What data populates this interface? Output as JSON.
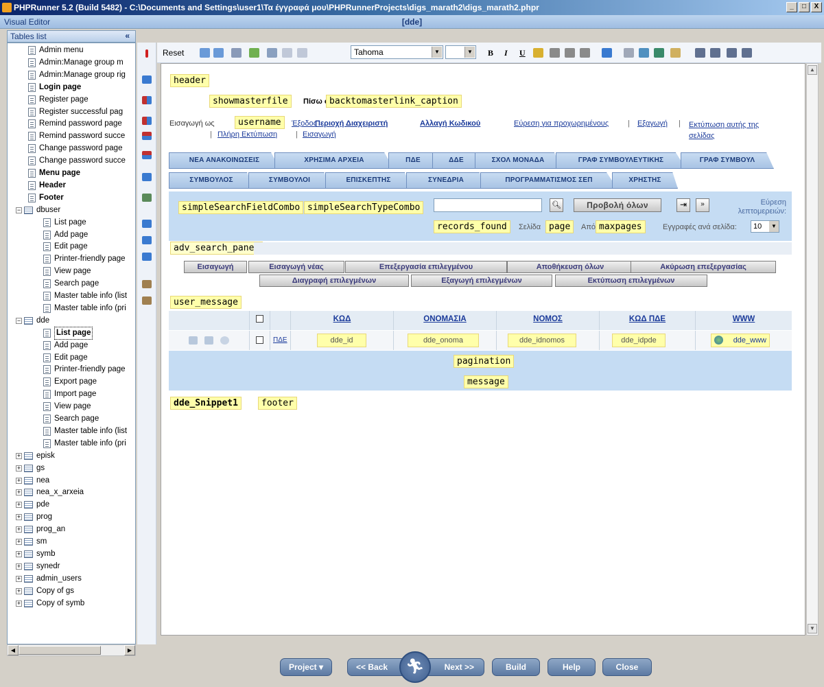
{
  "window": {
    "title": "PHPRunner 5.2 (Build 5482) - C:\\Documents and Settings\\user1\\Τα έγγραφά μου\\PHPRunnerProjects\\digs_marath2\\digs_marath2.phpr",
    "controls": [
      "_",
      "□",
      "X"
    ]
  },
  "editor_bar": {
    "label": "Visual Editor",
    "title": "[dde]"
  },
  "tables_panel": {
    "title": "Tables list",
    "collapse": "«",
    "items": [
      {
        "label": "Admin menu",
        "icon": "page-icon",
        "bold": false
      },
      {
        "label": "Admin:Manage group m",
        "icon": "page-icon",
        "bold": false
      },
      {
        "label": "Admin:Manage group rig",
        "icon": "page-icon",
        "bold": false
      },
      {
        "label": "Login page",
        "icon": "page-icon",
        "bold": true
      },
      {
        "label": "Register page",
        "icon": "page-icon",
        "bold": false
      },
      {
        "label": "Register successful pag",
        "icon": "page-icon",
        "bold": false
      },
      {
        "label": "Remind password page",
        "icon": "page-icon",
        "bold": false
      },
      {
        "label": "Remind password succe",
        "icon": "page-icon",
        "bold": false
      },
      {
        "label": "Change password page",
        "icon": "page-icon",
        "bold": false
      },
      {
        "label": "Change password succe",
        "icon": "page-icon",
        "bold": false
      },
      {
        "label": "Menu page",
        "icon": "page-icon",
        "bold": true
      },
      {
        "label": "Header",
        "icon": "page-icon",
        "bold": true
      },
      {
        "label": "Footer",
        "icon": "page-icon",
        "bold": true
      },
      {
        "label": "dbuser",
        "icon": "table-icon",
        "bold": false
      },
      {
        "label": "List page",
        "icon": "page-icon",
        "bold": false
      },
      {
        "label": "Add page",
        "icon": "add-icon",
        "bold": false
      },
      {
        "label": "Edit page",
        "icon": "edit-icon",
        "bold": false
      },
      {
        "label": "Printer-friendly page",
        "icon": "printer-icon",
        "bold": false
      },
      {
        "label": "View page",
        "icon": "view-icon",
        "bold": false
      },
      {
        "label": "Search page",
        "icon": "page-icon",
        "bold": false
      },
      {
        "label": "Master table info (list",
        "icon": "page-icon",
        "bold": false
      },
      {
        "label": "Master table info (pri",
        "icon": "printer-icon",
        "bold": false
      },
      {
        "label": "dde",
        "icon": "table-icon",
        "bold": false
      },
      {
        "label": "List page",
        "icon": "page-icon",
        "bold": true,
        "selected": true
      },
      {
        "label": "Add page",
        "icon": "add-icon",
        "bold": false
      },
      {
        "label": "Edit page",
        "icon": "edit-icon",
        "bold": false
      },
      {
        "label": "Printer-friendly page",
        "icon": "printer-icon",
        "bold": false
      },
      {
        "label": "Export page",
        "icon": "export-icon",
        "bold": false
      },
      {
        "label": "Import page",
        "icon": "import-icon",
        "bold": false
      },
      {
        "label": "View page",
        "icon": "view-icon",
        "bold": false
      },
      {
        "label": "Search page",
        "icon": "page-icon",
        "bold": false
      },
      {
        "label": "Master table info (list",
        "icon": "page-icon",
        "bold": false
      },
      {
        "label": "Master table info (pri",
        "icon": "printer-icon",
        "bold": false
      },
      {
        "label": "episk",
        "icon": "table-icon",
        "bold": false
      },
      {
        "label": "gs",
        "icon": "table-icon",
        "bold": false
      },
      {
        "label": "nea",
        "icon": "table-icon",
        "bold": false
      },
      {
        "label": "nea_x_arxeia",
        "icon": "table-icon",
        "bold": false
      },
      {
        "label": "pde",
        "icon": "table-icon",
        "bold": false
      },
      {
        "label": "prog",
        "icon": "table-icon",
        "bold": false
      },
      {
        "label": "prog_an",
        "icon": "table-icon",
        "bold": false
      },
      {
        "label": "sm",
        "icon": "table-icon",
        "bold": false
      },
      {
        "label": "symb",
        "icon": "table-icon",
        "bold": false
      },
      {
        "label": "synedr",
        "icon": "table-icon",
        "bold": false
      },
      {
        "label": "admin_users",
        "icon": "table-icon",
        "bold": false
      },
      {
        "label": "Copy of gs",
        "icon": "table-icon",
        "bold": false
      },
      {
        "label": "Copy of symb",
        "icon": "table-icon",
        "bold": false
      }
    ]
  },
  "toolbar": {
    "reset": "Reset",
    "font": "Tahoma",
    "size": "",
    "bold": "B",
    "italic": "I",
    "underline": "U"
  },
  "canvas": {
    "header": "header",
    "showmasterfile": "showmasterfile",
    "back_prefix": "Πίσω σε",
    "backtomaster": "backtomasterlink_caption",
    "login_as": "Εισαγωγή ως",
    "username": "username",
    "logout": "Έξοδος",
    "admin_area": "Περιοχή Διαχειριστή",
    "change_pw": "Αλλαγή Κωδικού",
    "adv_search": "Εύρεση για προχωρημένους",
    "export": "Εξαγωγή",
    "print_page": "Εκτύπωση αυτής της σελίδας",
    "print_all": "Πλήρη Εκτύπωση",
    "import": "Εισαγωγή",
    "sep": "|",
    "tabs_row1": [
      "ΝΕΑ ΑΝΑΚΟΙΝΩΣΕΙΣ",
      "ΧΡΗΣΙΜΑ ΑΡΧΕΙΑ",
      "ΠΔΕ",
      "ΔΔΕ",
      "ΣΧΟΛ ΜΟΝΑΔΑ",
      "ΓΡΑΦ ΣΥΜΒΟΥΛΕΥΤΙΚΗΣ",
      "ΓΡΑΦ ΣΥΜΒΟΥΛ"
    ],
    "tabs_row2": [
      "ΣΥΜΒΟΥΛΟΣ",
      "ΣΥΜΒΟΥΛΟΙ",
      "ΕΠΙΣΚΕΠΤΗΣ",
      "ΣΥΝΕΔΡΙΑ",
      "ΠΡΟΓΡΑΜΜΑΤΙΣΜΟΣ ΣΕΠ",
      "ΧΡΗΣΤΗΣ"
    ],
    "search_field_combo": "simpleSearchFieldCombo",
    "search_type_combo": "simpleSearchTypeCombo",
    "search_value": "",
    "show_all": "Προβολή όλων",
    "details_search": "Εύρεση λεπτομερειών:",
    "records_found": "records_found",
    "page_label": "Σελίδα",
    "page": "page",
    "of_label": "Από",
    "maxpages": "maxpages",
    "per_page_label": "Εγγραφές ανά σελίδα:",
    "per_page": "10",
    "adv_search_panel": "adv_search_panel",
    "action_buttons_row1": [
      "Εισαγωγή",
      "Εισαγωγή νέας",
      "Επεξεργασία επιλεγμένου",
      "Αποθήκευση όλων",
      "Ακύρωση επεξεργασίας"
    ],
    "action_buttons_row2": [
      "Διαγραφή επιλεγμένων",
      "Εξαγωγή επιλεγμένων",
      "Εκτύπωση επιλεγμένων"
    ],
    "user_message": "user_message",
    "grid_headers": [
      "ΚΩΔ",
      "ΟΝΟΜΑΣΙΑ",
      "ΝΟΜΟΣ",
      "ΚΩΔ ΠΔΕ",
      "WWW"
    ],
    "row_link": "ΠΔΕ",
    "row_fields": [
      "dde_id",
      "dde_onoma",
      "dde_idnomos",
      "dde_idpde",
      "dde_www"
    ],
    "pagination": "pagination",
    "message": "message",
    "snippet": "dde_Snippet1",
    "footer": "footer"
  },
  "nav": {
    "project": "Project",
    "back": "<< Back",
    "next": "Next >>",
    "build": "Build",
    "help": "Help",
    "close": "Close"
  }
}
